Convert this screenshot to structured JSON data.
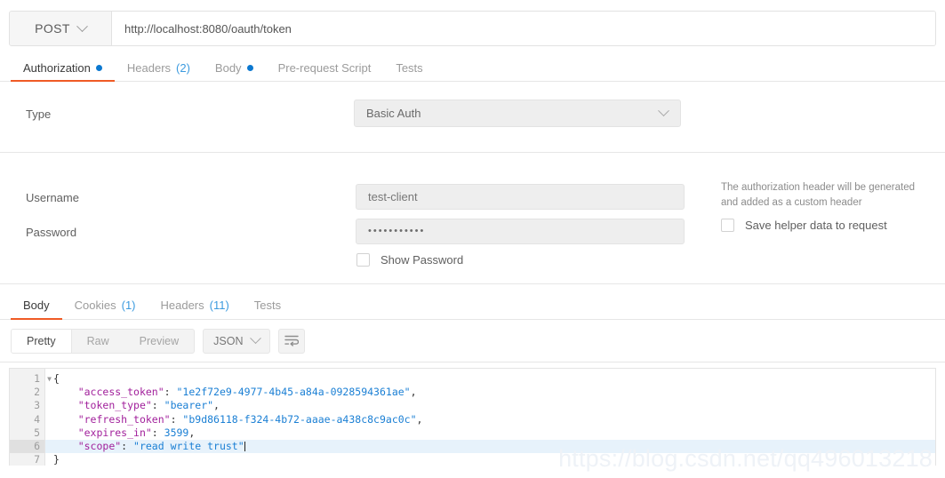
{
  "request": {
    "method": "POST",
    "url": "http://localhost:8080/oauth/token",
    "tabs": [
      {
        "label": "Authorization",
        "indicator": "dot",
        "active": true
      },
      {
        "label": "Headers",
        "count": "(2)",
        "active": false
      },
      {
        "label": "Body",
        "indicator": "dot",
        "active": false
      },
      {
        "label": "Pre-request Script",
        "active": false
      },
      {
        "label": "Tests",
        "active": false
      }
    ]
  },
  "auth": {
    "type_label": "Type",
    "type_value": "Basic Auth",
    "username_label": "Username",
    "username_value": "test-client",
    "password_label": "Password",
    "password_value": "•••••••••••",
    "show_password_label": "Show Password",
    "helper_note": "The authorization header will be generated and added as a custom header",
    "save_helper_label": "Save helper data to request"
  },
  "response": {
    "tabs": [
      {
        "label": "Body",
        "active": true
      },
      {
        "label": "Cookies",
        "count": "(1)",
        "active": false
      },
      {
        "label": "Headers",
        "count": "(11)",
        "active": false
      },
      {
        "label": "Tests",
        "active": false
      }
    ],
    "view_modes": [
      {
        "label": "Pretty",
        "active": true
      },
      {
        "label": "Raw",
        "active": false
      },
      {
        "label": "Preview",
        "active": false
      }
    ],
    "format": "JSON",
    "wrap_icon": "word-wrap-icon",
    "body": {
      "line_numbers": [
        "1",
        "2",
        "3",
        "4",
        "5",
        "6",
        "7"
      ],
      "active_line": 6,
      "lines": [
        {
          "text": "{"
        },
        {
          "key": "\"access_token\"",
          "sep": ": ",
          "value": "\"1e2f72e9-4977-4b45-a84a-0928594361ae\"",
          "tail": ","
        },
        {
          "key": "\"token_type\"",
          "sep": ": ",
          "value": "\"bearer\"",
          "tail": ","
        },
        {
          "key": "\"refresh_token\"",
          "sep": ": ",
          "value": "\"b9d86118-f324-4b72-aaae-a438c8c9ac0c\"",
          "tail": ","
        },
        {
          "key": "\"expires_in\"",
          "sep": ": ",
          "value": "3599",
          "tail": ","
        },
        {
          "key": "\"scope\"",
          "sep": ": ",
          "value": "\"read write trust\"",
          "tail": ""
        },
        {
          "text": "}"
        }
      ]
    }
  },
  "watermark": "https://blog.csdn.net/qq496013218",
  "colors": {
    "accent": "#ef5b25",
    "link": "#3c9bdf",
    "dot": "#0b78d0",
    "json_key": "#a11f9b",
    "json_string": "#1a7fd4"
  }
}
